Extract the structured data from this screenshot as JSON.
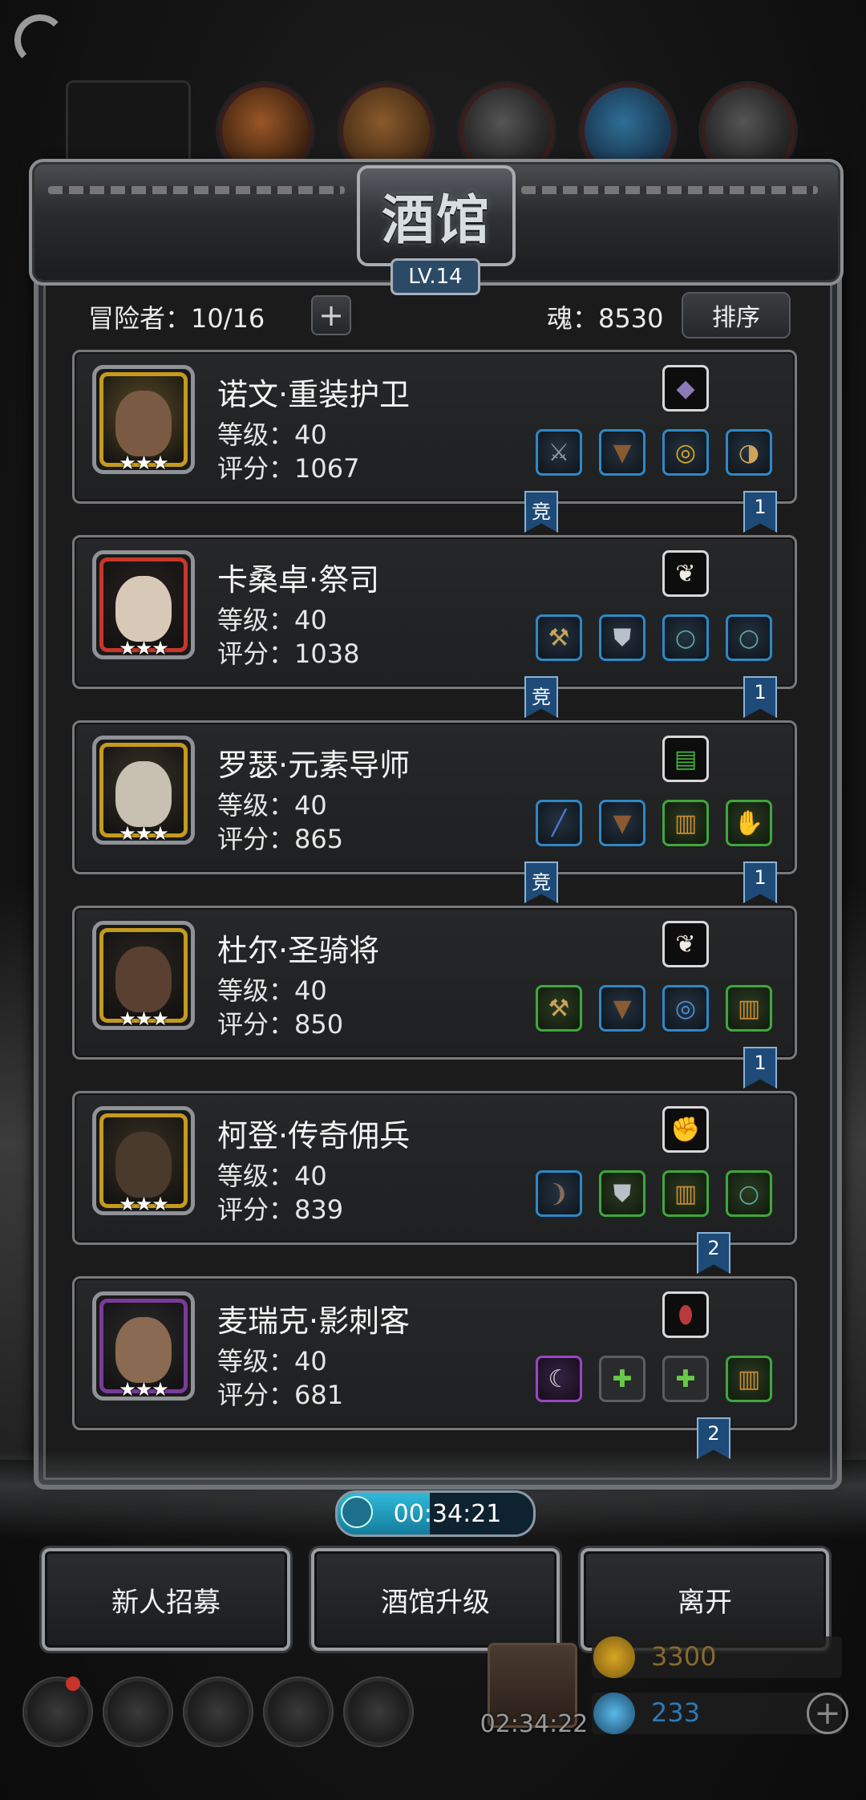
{
  "panel": {
    "title": "酒馆",
    "level": "LV.14",
    "adventurers_label": "冒险者：10/16",
    "soul_label": "魂：8530",
    "sort_label": "排序",
    "add_symbol": "+"
  },
  "heroes": [
    {
      "name": "诺文·重装护卫",
      "level": "等级：40",
      "score": "评分：1067",
      "stars": "★★★",
      "frame": "#c59a1d",
      "face": "#7a5a42",
      "bg": "#5a4a25",
      "top_slot": {
        "icon": "crystal-icon",
        "glyph": "◆",
        "color": "#8c7ab8"
      },
      "slots": [
        {
          "icon": "sword-icon",
          "glyph": "⚔",
          "color": "#9a9a9a",
          "rarity": "blue"
        },
        {
          "icon": "armor-icon",
          "glyph": "▼",
          "color": "#8a5a32",
          "rarity": "blue"
        },
        {
          "icon": "ring-icon",
          "glyph": "◎",
          "color": "#d8a622",
          "rarity": "blue"
        },
        {
          "icon": "horn-icon",
          "glyph": "◑",
          "color": "#cfa35a",
          "rarity": "blue"
        }
      ],
      "ribbons": [
        {
          "text": "竞"
        },
        {
          "text": "1"
        }
      ]
    },
    {
      "name": "卡桑卓·祭司",
      "level": "等级：40",
      "score": "评分：1038",
      "stars": "★★★",
      "frame": "#c8362a",
      "face": "#d8c8b8",
      "bg": "#2a1f1f",
      "top_slot": {
        "icon": "feather-icon",
        "glyph": "❦",
        "color": "#f0ece2"
      },
      "slots": [
        {
          "icon": "hammer-icon",
          "glyph": "⚒",
          "color": "#c9a55a",
          "rarity": "blue"
        },
        {
          "icon": "chest-armor-icon",
          "glyph": "⛊",
          "color": "#b8c0c8",
          "rarity": "blue"
        },
        {
          "icon": "ring-icon",
          "glyph": "○",
          "color": "#5aa8a0",
          "rarity": "blue"
        },
        {
          "icon": "ring-icon",
          "glyph": "○",
          "color": "#5aa8a0",
          "rarity": "blue"
        }
      ],
      "ribbons": [
        {
          "text": "竞"
        },
        {
          "text": "1"
        }
      ]
    },
    {
      "name": "罗瑟·元素导师",
      "level": "等级：40",
      "score": "评分：865",
      "stars": "★★★",
      "frame": "#c59a1d",
      "face": "#c8c0b0",
      "bg": "#3a3226",
      "top_slot": {
        "icon": "spellbook-icon",
        "glyph": "▤",
        "color": "#3fb83a"
      },
      "slots": [
        {
          "icon": "staff-icon",
          "glyph": "╱",
          "color": "#4a7ad8",
          "rarity": "blue"
        },
        {
          "icon": "armor-icon",
          "glyph": "▼",
          "color": "#8a5a32",
          "rarity": "blue"
        },
        {
          "icon": "leg-armor-icon",
          "glyph": "▥",
          "color": "#c98a32",
          "rarity": "green"
        },
        {
          "icon": "gauntlet-icon",
          "glyph": "✋",
          "color": "#b8b8b8",
          "rarity": "green"
        }
      ],
      "ribbons": [
        {
          "text": "竞"
        },
        {
          "text": "1"
        }
      ]
    },
    {
      "name": "杜尔·圣骑将",
      "level": "等级：40",
      "score": "评分：850",
      "stars": "★★★",
      "frame": "#c59a1d",
      "face": "#5a4030",
      "bg": "#2a2420",
      "top_slot": {
        "icon": "feather-icon",
        "glyph": "❦",
        "color": "#f0ece2"
      },
      "slots": [
        {
          "icon": "hammer-icon",
          "glyph": "⚒",
          "color": "#c9a55a",
          "rarity": "green"
        },
        {
          "icon": "armor-icon",
          "glyph": "▼",
          "color": "#8a5a32",
          "rarity": "blue"
        },
        {
          "icon": "ring-icon",
          "glyph": "◎",
          "color": "#4a90d8",
          "rarity": "blue"
        },
        {
          "icon": "leg-armor-icon",
          "glyph": "▥",
          "color": "#c98a32",
          "rarity": "green"
        }
      ],
      "ribbons": [
        {
          "text": "1"
        }
      ]
    },
    {
      "name": "柯登·传奇佣兵",
      "level": "等级：40",
      "score": "评分：839",
      "stars": "★★★",
      "frame": "#c59a1d",
      "face": "#4a3a2c",
      "bg": "#3a3020",
      "top_slot": {
        "icon": "glove-icon",
        "glyph": "✊",
        "color": "#2a2a2a"
      },
      "slots": [
        {
          "icon": "dagger-icon",
          "glyph": "❩",
          "color": "#8a6a5a",
          "rarity": "blue"
        },
        {
          "icon": "chest-armor-icon",
          "glyph": "⛊",
          "color": "#b8c0c8",
          "rarity": "green"
        },
        {
          "icon": "leg-armor-icon",
          "glyph": "▥",
          "color": "#c98a32",
          "rarity": "green"
        },
        {
          "icon": "ring-icon",
          "glyph": "○",
          "color": "#5aa8a0",
          "rarity": "green"
        }
      ],
      "ribbons": [
        {
          "text": "2"
        }
      ]
    },
    {
      "name": "麦瑞克·影刺客",
      "level": "等级：40",
      "score": "评分：681",
      "stars": "★★★",
      "frame": "#7a3a9a",
      "face": "#8a6a52",
      "bg": "#2a2a2a",
      "top_slot": {
        "icon": "bracer-icon",
        "glyph": "⬮",
        "color": "#b83a3a"
      },
      "slots": [
        {
          "icon": "curved-blade-icon",
          "glyph": "☾",
          "color": "#e0e0e0",
          "rarity": "purple"
        },
        {
          "icon": "empty-armor-slot-icon",
          "glyph": "✚",
          "color": "#6ac84a",
          "rarity": "empty"
        },
        {
          "icon": "empty-ring-slot-icon",
          "glyph": "✚",
          "color": "#6ac84a",
          "rarity": "empty"
        },
        {
          "icon": "leg-armor-icon",
          "glyph": "▥",
          "color": "#c98a32",
          "rarity": "green"
        }
      ],
      "ribbons": [
        {
          "text": "2"
        }
      ]
    }
  ],
  "timer": {
    "text": "00:34:21",
    "progress": 0.47
  },
  "actions": {
    "recruit": "新人招募",
    "upgrade": "酒馆升级",
    "leave": "离开"
  },
  "footer": {
    "gift_timer": "02:34:22",
    "gold": "3300",
    "gems": "233",
    "plus_symbol": "+"
  },
  "colors": {
    "accent_blue": "#2e88c8",
    "rarity_green": "#3ea83a",
    "rarity_purple": "#9a46c6",
    "timer_fill": "#2fb9d9"
  }
}
